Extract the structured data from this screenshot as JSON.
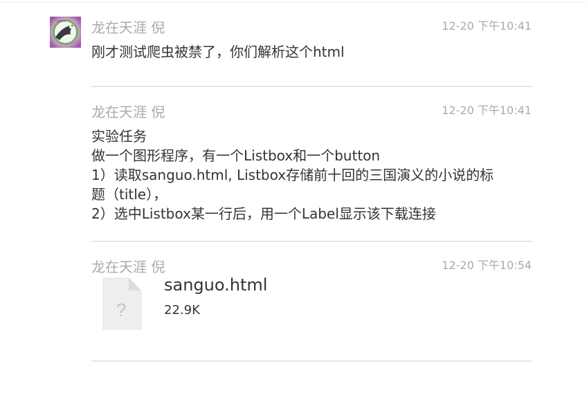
{
  "messages": [
    {
      "sender": "龙在天涯 倪",
      "time": "12-20 下午10:41",
      "lines": [
        "刚才测试爬虫被禁了，你们解析这个html"
      ]
    },
    {
      "sender": "龙在天涯 倪",
      "time": "12-20 下午10:41",
      "lines": [
        "实验任务",
        "做一个图形程序，有一个Listbox和一个button",
        "1）读取sanguo.html, Listbox存储前十回的三国演义的小说的标",
        "题（title），",
        "2）选中Listbox某一行后，用一个Label显示该下载连接"
      ]
    },
    {
      "sender": "龙在天涯 倪",
      "time": "12-20 下午10:54",
      "file": {
        "name": "sanguo.html",
        "size": "22.9K",
        "icon_glyph": "?"
      }
    }
  ],
  "icons": {
    "avatar": "user-avatar",
    "file": "unknown-file-icon"
  },
  "colors": {
    "meta_text": "#aaaaaa",
    "body_text": "#333333",
    "divider": "#e5e5e5",
    "file_icon_bg": "#eeeeee"
  }
}
